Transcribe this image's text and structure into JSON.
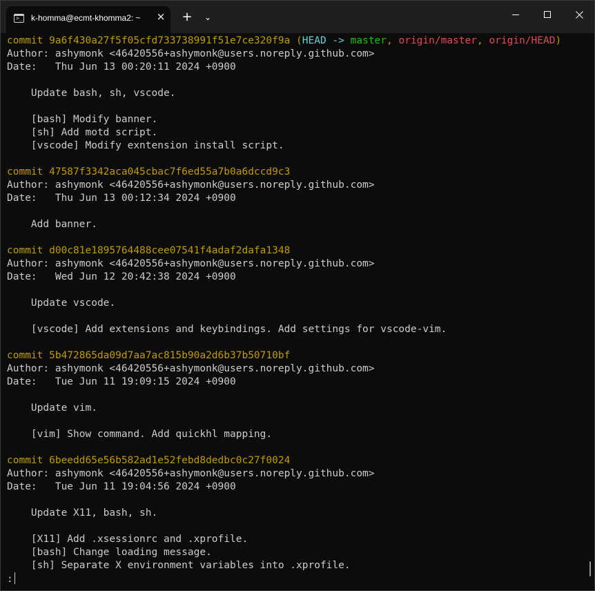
{
  "window": {
    "tab_title": "k-homma@ecmt-khomma2: ~",
    "tab_close": "×",
    "new_tab": "+",
    "dropdown": "⌄"
  },
  "commits": [
    {
      "commit_label": "commit ",
      "hash": "9a6f430a27f5f05cfd733738991f51e7ce320f9a",
      "refs": true,
      "head": "HEAD -> ",
      "branch": "master",
      "remote1": "origin/master",
      "remote2": "origin/HEAD",
      "author": "Author: ashymonk <46420556+ashymonk@users.noreply.github.com>",
      "date": "Date:   Thu Jun 13 00:20:11 2024 +0900",
      "message": [
        "    Update bash, sh, vscode.",
        "",
        "    [bash] Modify banner.",
        "    [sh] Add motd script.",
        "    [vscode] Modify exntension install script."
      ]
    },
    {
      "commit_label": "commit ",
      "hash": "47587f3342aca045cbac7f6ed55a7b0a6dccd9c3",
      "refs": false,
      "author": "Author: ashymonk <46420556+ashymonk@users.noreply.github.com>",
      "date": "Date:   Thu Jun 13 00:12:34 2024 +0900",
      "message": [
        "    Add banner."
      ]
    },
    {
      "commit_label": "commit ",
      "hash": "d00c81e1895764488cee07541f4adaf2dafa1348",
      "refs": false,
      "author": "Author: ashymonk <46420556+ashymonk@users.noreply.github.com>",
      "date": "Date:   Wed Jun 12 20:42:38 2024 +0900",
      "message": [
        "    Update vscode.",
        "",
        "    [vscode] Add extensions and keybindings. Add settings for vscode-vim."
      ]
    },
    {
      "commit_label": "commit ",
      "hash": "5b472865da09d7aa7ac815b90a2d6b37b50710bf",
      "refs": false,
      "author": "Author: ashymonk <46420556+ashymonk@users.noreply.github.com>",
      "date": "Date:   Tue Jun 11 19:09:15 2024 +0900",
      "message": [
        "    Update vim.",
        "",
        "    [vim] Show command. Add quickhl mapping."
      ]
    },
    {
      "commit_label": "commit ",
      "hash": "6beedd65e56b582ad1e52febd8dedbc0c27f0024",
      "refs": false,
      "author": "Author: ashymonk <46420556+ashymonk@users.noreply.github.com>",
      "date": "Date:   Tue Jun 11 19:04:56 2024 +0900",
      "message": [
        "    Update X11, bash, sh.",
        "",
        "    [X11] Add .xsessionrc and .xprofile.",
        "    [bash] Change loading message.",
        "    [sh] Separate X environment variables into .xprofile."
      ]
    }
  ],
  "pager_prompt": ":",
  "colors": {
    "background": "#0c0c0c",
    "text": "#cccccc",
    "commit": "#c19c00",
    "head": "#61d6d6",
    "branch": "#16c60c",
    "remote": "#e74856"
  }
}
